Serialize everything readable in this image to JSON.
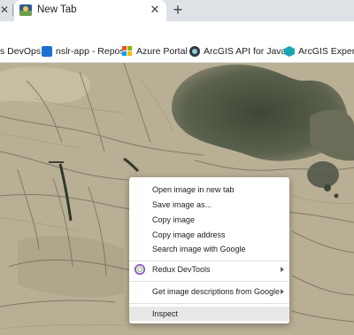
{
  "tabs": {
    "active": {
      "title": "New Tab",
      "favicon": "landscape-icon"
    },
    "new_tab_symbol": "+",
    "close_symbol": "✕"
  },
  "bookmarks": [
    {
      "label": "s DevOps",
      "icon": "azure-devops-icon"
    },
    {
      "label": "nslr-app - Repos",
      "icon": "repos-icon"
    },
    {
      "label": "Azure Portal",
      "icon": "microsoft-icon"
    },
    {
      "label": "ArcGIS API for Java...",
      "icon": "arcgis-globe-icon"
    },
    {
      "label": "ArcGIS Experience",
      "icon": "arcgis-experience-icon"
    }
  ],
  "context_menu": {
    "items": [
      {
        "label": "Open image in new tab"
      },
      {
        "label": "Save image as..."
      },
      {
        "label": "Copy image"
      },
      {
        "label": "Copy image address"
      },
      {
        "label": "Search image with Google"
      },
      {
        "label": "Redux DevTools",
        "submenu": true,
        "icon": "redux-icon"
      },
      {
        "label": "Get image descriptions from Google",
        "submenu": true
      },
      {
        "label": "Inspect",
        "highlighted": true
      }
    ]
  },
  "colors": {
    "tabstrip": "#dee1e6",
    "menu_hover": "#e8e8e8",
    "desert": "#b8ad92"
  }
}
